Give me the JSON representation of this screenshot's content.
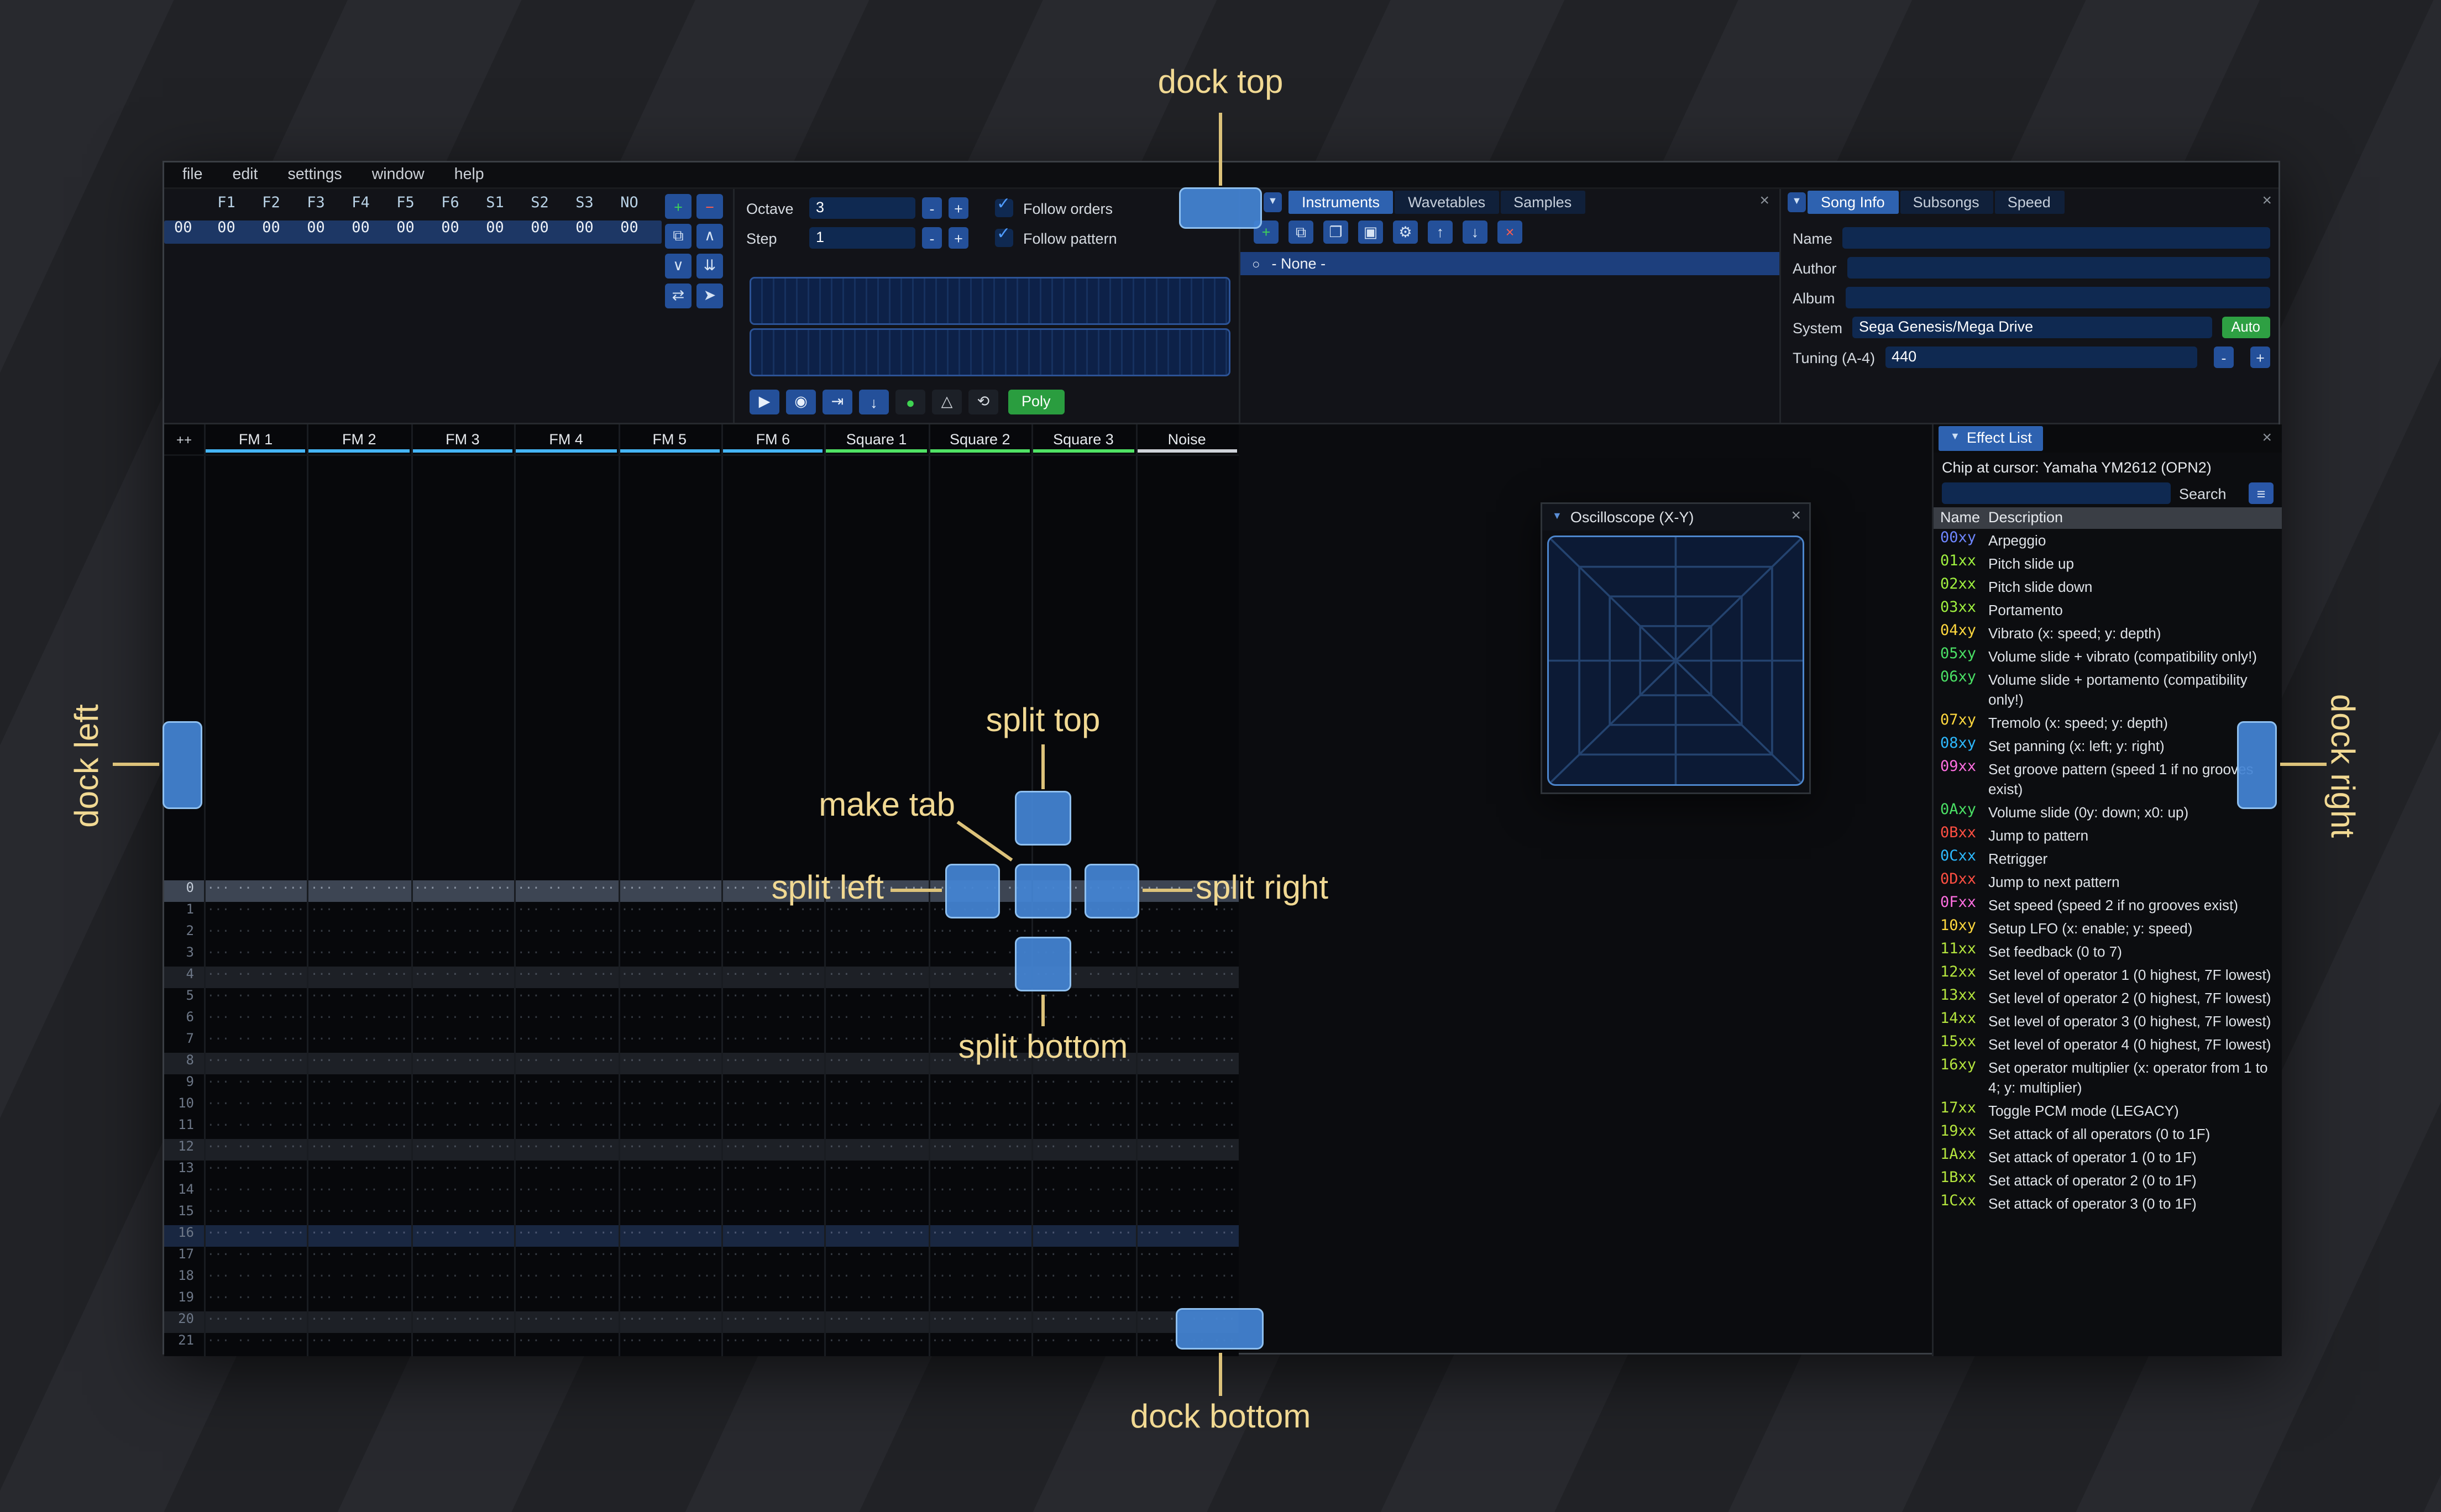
{
  "icons": {
    "dropdown": "▼",
    "collapse": "▼",
    "close": "×",
    "radio": "○",
    "menu_burger": "≡",
    "minus": "-",
    "plus": "+"
  },
  "menu": {
    "items": [
      "file",
      "edit",
      "settings",
      "window",
      "help"
    ]
  },
  "orders": {
    "columns": [
      "F1",
      "F2",
      "F3",
      "F4",
      "F5",
      "F6",
      "S1",
      "S2",
      "S3",
      "NO"
    ],
    "rows": [
      {
        "index": "00",
        "cells": [
          "00",
          "00",
          "00",
          "00",
          "00",
          "00",
          "00",
          "00",
          "00",
          "00"
        ]
      }
    ],
    "buttons": [
      {
        "name": "order-add-button",
        "glyph": "+",
        "color": "#3ed158"
      },
      {
        "name": "order-remove-button",
        "glyph": "−",
        "color": "#ff5c4f"
      },
      {
        "name": "order-duplicate-button",
        "glyph": "⧉",
        "color": "#d7e4f4"
      },
      {
        "name": "order-move-up-button",
        "glyph": "∧",
        "color": "#d7e4f4"
      },
      {
        "name": "order-move-down-button",
        "glyph": "∨",
        "color": "#d7e4f4"
      },
      {
        "name": "order-duplicate-end-button",
        "glyph": "⇊",
        "color": "#d7e4f4"
      },
      {
        "name": "order-change-mode-button",
        "glyph": "⇄",
        "color": "#d7e4f4"
      },
      {
        "name": "order-edit-mode-button",
        "glyph": "➤",
        "color": "#d7e4f4"
      }
    ]
  },
  "controls": {
    "octave_label": "Octave",
    "octave_value": "3",
    "step_label": "Step",
    "step_value": "1",
    "follow_orders_label": "Follow orders",
    "follow_pattern_label": "Follow pattern",
    "play_buttons": [
      {
        "name": "play-button",
        "glyph": "▶",
        "style": "blue"
      },
      {
        "name": "stop-button",
        "glyph": "◉",
        "style": "blue"
      },
      {
        "name": "play-pattern-button",
        "glyph": "⇥",
        "style": "blue"
      },
      {
        "name": "step-row-button",
        "glyph": "↓",
        "style": "blue"
      },
      {
        "name": "edit-record-button",
        "glyph": "●",
        "style": "record"
      },
      {
        "name": "metronome-button",
        "glyph": "△",
        "style": "dark"
      },
      {
        "name": "repeat-pattern-button",
        "glyph": "⟲",
        "style": "dark"
      }
    ],
    "poly_label": "Poly"
  },
  "instruments": {
    "tabs": [
      {
        "label": "Instruments",
        "selected": true
      },
      {
        "label": "Wavetables",
        "selected": false
      },
      {
        "label": "Samples",
        "selected": false
      }
    ],
    "toolbar": [
      {
        "name": "instrument-add-button",
        "glyph": "+",
        "color": "#3ed158"
      },
      {
        "name": "instrument-duplicate-button",
        "glyph": "⧉",
        "color": "#d7e4f4"
      },
      {
        "name": "instrument-open-button",
        "glyph": "❐",
        "color": "#d7e4f4"
      },
      {
        "name": "instrument-save-button",
        "glyph": "▣",
        "color": "#d7e4f4"
      },
      {
        "name": "instrument-organize-button",
        "glyph": "⚙",
        "color": "#d7e4f4"
      },
      {
        "name": "instrument-move-up-button",
        "glyph": "↑",
        "color": "#d7e4f4"
      },
      {
        "name": "instrument-move-down-button",
        "glyph": "↓",
        "color": "#d7e4f4"
      },
      {
        "name": "instrument-delete-button",
        "glyph": "×",
        "color": "#ff5c4f"
      }
    ],
    "items": [
      {
        "label": "- None -",
        "selected": true
      }
    ]
  },
  "song_info": {
    "tabs": [
      {
        "label": "Song Info",
        "selected": true
      },
      {
        "label": "Subsongs",
        "selected": false
      },
      {
        "label": "Speed",
        "selected": false
      }
    ],
    "name_label": "Name",
    "name_value": "",
    "author_label": "Author",
    "author_value": "",
    "album_label": "Album",
    "album_value": "",
    "system_label": "System",
    "system_value": "Sega Genesis/Mega Drive",
    "auto_label": "Auto",
    "tuning_label": "Tuning (A-4)",
    "tuning_value": "440"
  },
  "pattern": {
    "corner_label": "++",
    "channels": [
      {
        "name": "FM 1",
        "color": "#45b5f5"
      },
      {
        "name": "FM 2",
        "color": "#45b5f5"
      },
      {
        "name": "FM 3",
        "color": "#45b5f5"
      },
      {
        "name": "FM 4",
        "color": "#45b5f5"
      },
      {
        "name": "FM 5",
        "color": "#45b5f5"
      },
      {
        "name": "FM 6",
        "color": "#45b5f5"
      },
      {
        "name": "Square 1",
        "color": "#4fe264"
      },
      {
        "name": "Square 2",
        "color": "#4fe264"
      },
      {
        "name": "Square 3",
        "color": "#4fe264"
      },
      {
        "name": "Noise",
        "color": "#d0d4da"
      }
    ],
    "rows": [
      "0",
      "1",
      "2",
      "3",
      "4",
      "5",
      "6",
      "7",
      "8",
      "9",
      "10",
      "11",
      "12",
      "13",
      "14",
      "15",
      "16",
      "17",
      "18",
      "19",
      "20",
      "21"
    ],
    "cursor_row": 0,
    "empty_cell": "··· ·· ·· ···"
  },
  "oscilloscope": {
    "title": "Oscilloscope (X-Y)"
  },
  "effect_list": {
    "title": "Effect List",
    "chip_line": "Chip at cursor: Yamaha YM2612 (OPN2)",
    "search_value": "",
    "search_label": "Search",
    "name_col": "Name",
    "desc_col": "Description",
    "effects": [
      {
        "code": "00xy",
        "color": "#6e86ff",
        "desc": "Arpeggio"
      },
      {
        "code": "01xx",
        "color": "#9ff03f",
        "desc": "Pitch slide up"
      },
      {
        "code": "02xx",
        "color": "#9ff03f",
        "desc": "Pitch slide down"
      },
      {
        "code": "03xx",
        "color": "#9ff03f",
        "desc": "Portamento"
      },
      {
        "code": "04xy",
        "color": "#ffd83e",
        "desc": "Vibrato (x: speed; y: depth)"
      },
      {
        "code": "05xy",
        "color": "#4ae065",
        "desc": "Volume slide + vibrato (compatibility only!)"
      },
      {
        "code": "06xy",
        "color": "#4ae065",
        "desc": "Volume slide + portamento (compatibility only!)"
      },
      {
        "code": "07xy",
        "color": "#ffd83e",
        "desc": "Tremolo (x: speed; y: depth)"
      },
      {
        "code": "08xy",
        "color": "#2db9ff",
        "desc": "Set panning (x: left; y: right)"
      },
      {
        "code": "09xx",
        "color": "#ff6ee0",
        "desc": "Set groove pattern (speed 1 if no grooves exist)"
      },
      {
        "code": "0Axy",
        "color": "#4ae065",
        "desc": "Volume slide (0y: down; x0: up)"
      },
      {
        "code": "0Bxx",
        "color": "#ff4f42",
        "desc": "Jump to pattern"
      },
      {
        "code": "0Cxx",
        "color": "#2db9ff",
        "desc": "Retrigger"
      },
      {
        "code": "0Dxx",
        "color": "#ff4f42",
        "desc": "Jump to next pattern"
      },
      {
        "code": "0Fxx",
        "color": "#ff6ee0",
        "desc": "Set speed (speed 2 if no grooves exist)"
      },
      {
        "code": "10xy",
        "color": "#ffd83e",
        "desc": "Setup LFO (x: enable; y: speed)"
      },
      {
        "code": "11xx",
        "color": "#b4e53e",
        "desc": "Set feedback (0 to 7)"
      },
      {
        "code": "12xx",
        "color": "#b4e53e",
        "desc": "Set level of operator 1 (0 highest, 7F lowest)"
      },
      {
        "code": "13xx",
        "color": "#b4e53e",
        "desc": "Set level of operator 2 (0 highest, 7F lowest)"
      },
      {
        "code": "14xx",
        "color": "#b4e53e",
        "desc": "Set level of operator 3 (0 highest, 7F lowest)"
      },
      {
        "code": "15xx",
        "color": "#b4e53e",
        "desc": "Set level of operator 4 (0 highest, 7F lowest)"
      },
      {
        "code": "16xy",
        "color": "#b4e53e",
        "desc": "Set operator multiplier (x: operator from 1 to 4; y: multiplier)"
      },
      {
        "code": "17xx",
        "color": "#b4e53e",
        "desc": "Toggle PCM mode (LEGACY)"
      },
      {
        "code": "19xx",
        "color": "#b4e53e",
        "desc": "Set attack of all operators (0 to 1F)"
      },
      {
        "code": "1Axx",
        "color": "#b4e53e",
        "desc": "Set attack of operator 1 (0 to 1F)"
      },
      {
        "code": "1Bxx",
        "color": "#b4e53e",
        "desc": "Set attack of operator 2 (0 to 1F)"
      },
      {
        "code": "1Cxx",
        "color": "#b4e53e",
        "desc": "Set attack of operator 3 (0 to 1F)"
      }
    ]
  },
  "overlay": {
    "dock_top": "dock top",
    "dock_bottom": "dock bottom",
    "dock_left": "dock left",
    "dock_right": "dock right",
    "split_top": "split top",
    "split_bottom": "split bottom",
    "split_left": "split left",
    "split_right": "split right",
    "make_tab": "make tab"
  }
}
